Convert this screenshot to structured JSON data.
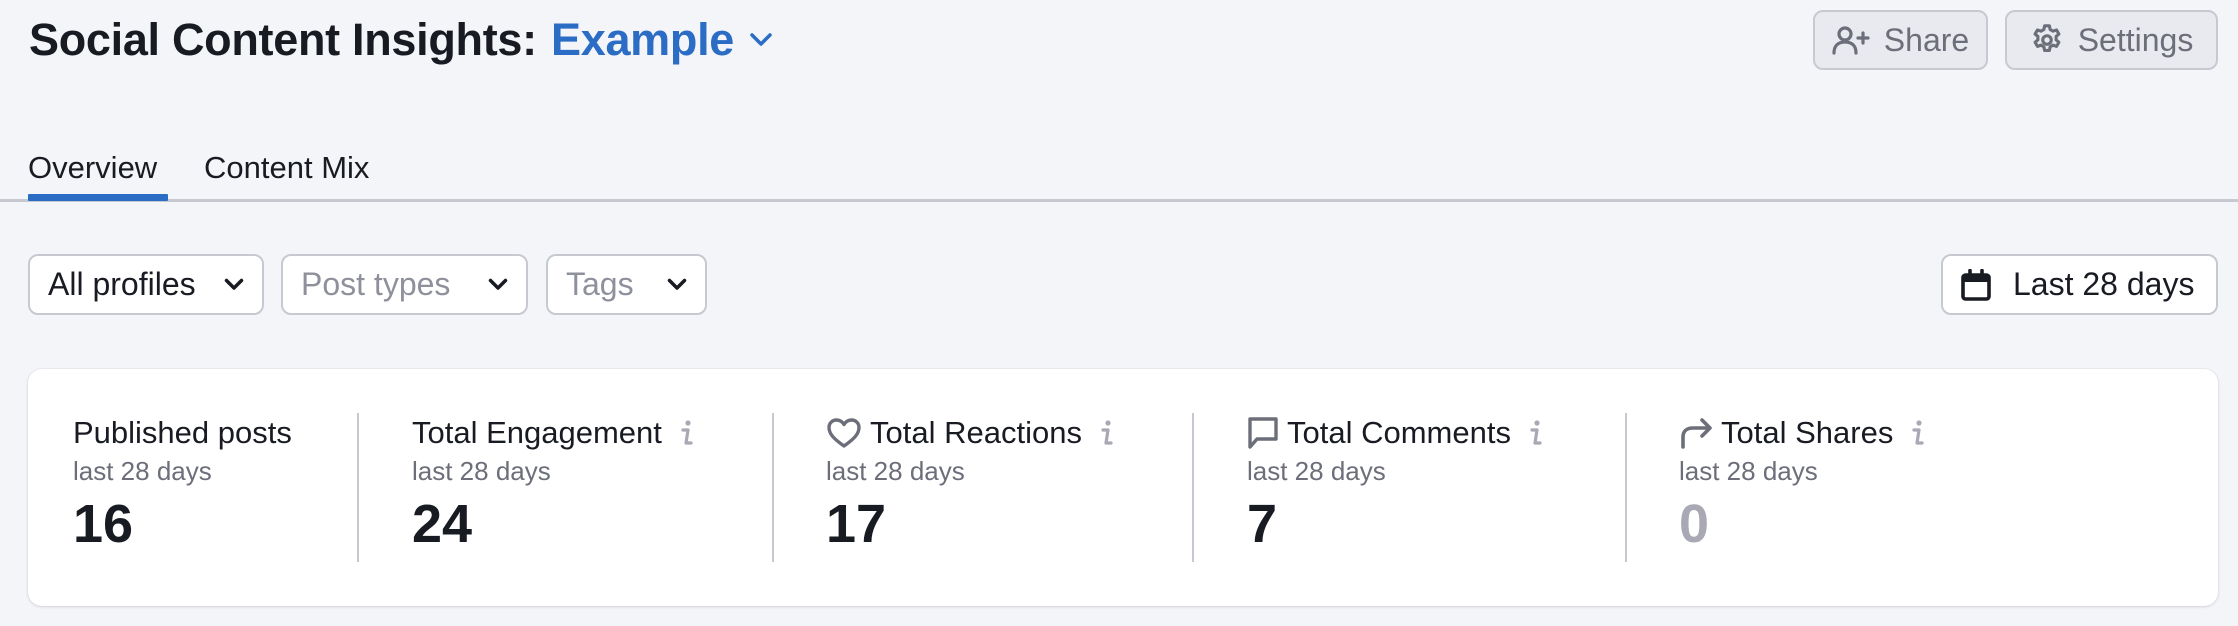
{
  "header": {
    "title": "Social Content Insights:",
    "project_name": "Example",
    "share_label": "Share",
    "settings_label": "Settings"
  },
  "tabs": [
    {
      "label": "Overview",
      "active": true
    },
    {
      "label": "Content Mix",
      "active": false
    }
  ],
  "filters": {
    "profiles": {
      "label": "All profiles",
      "is_placeholder": false
    },
    "post_types": {
      "label": "Post types",
      "is_placeholder": true
    },
    "tags": {
      "label": "Tags",
      "is_placeholder": true
    },
    "date_range": {
      "label": "Last 28 days",
      "icon": "calendar-icon"
    }
  },
  "metrics": [
    {
      "title": "Published posts",
      "period": "last 28 days",
      "value": "16",
      "icon": null,
      "has_info": false
    },
    {
      "title": "Total Engagement",
      "period": "last 28 days",
      "value": "24",
      "icon": null,
      "has_info": true
    },
    {
      "title": "Total Reactions",
      "period": "last 28 days",
      "value": "17",
      "icon": "heart-icon",
      "has_info": true
    },
    {
      "title": "Total Comments",
      "period": "last 28 days",
      "value": "7",
      "icon": "comment-icon",
      "has_info": true
    },
    {
      "title": "Total Shares",
      "period": "last 28 days",
      "value": "0",
      "icon": "share-arrow-icon",
      "has_info": true
    }
  ],
  "colors": {
    "accent": "#2B6CC4",
    "page_background": "#F4F5F9",
    "text_primary": "#191B23",
    "text_secondary": "#6C6E79",
    "muted_value": "#A8A9B4"
  }
}
